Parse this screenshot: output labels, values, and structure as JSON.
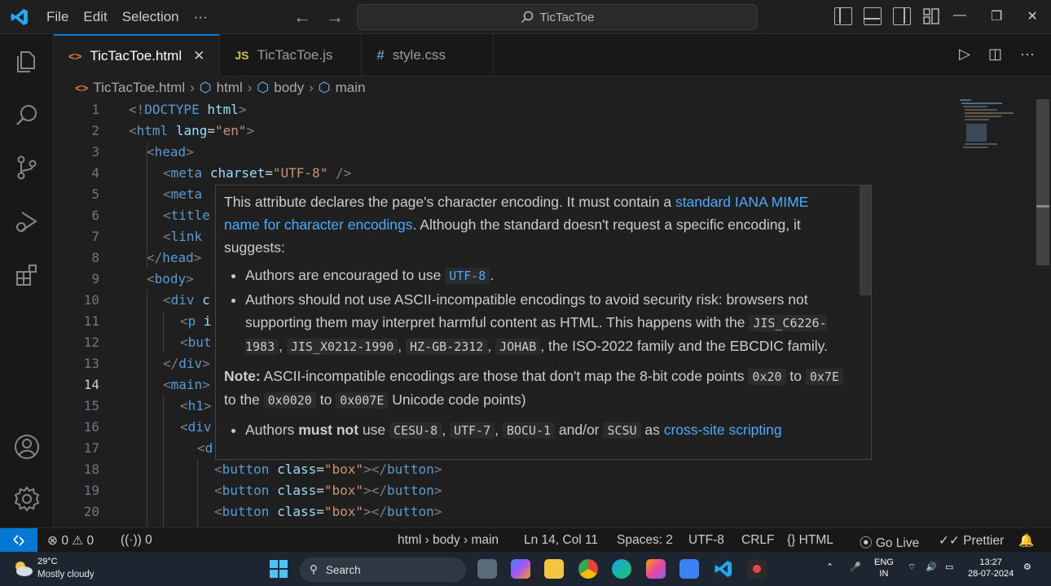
{
  "menu": {
    "file": "File",
    "edit": "Edit",
    "selection": "Selection",
    "more": "···"
  },
  "command_center": {
    "text": "TicTacToe"
  },
  "tabs": [
    {
      "icon_text": "<>",
      "label": "TicTacToe.html",
      "close": "✕"
    },
    {
      "icon_text": "JS",
      "label": "TicTacToe.js"
    },
    {
      "icon_text": "#",
      "label": "style.css"
    }
  ],
  "breadcrumb": {
    "file": "TicTacToe.html",
    "items": [
      "html",
      "body",
      "main"
    ]
  },
  "code_lines": [
    {
      "n": "1"
    },
    {
      "n": "2"
    },
    {
      "n": "3"
    },
    {
      "n": "4"
    },
    {
      "n": "5"
    },
    {
      "n": "6"
    },
    {
      "n": "7"
    },
    {
      "n": "8"
    },
    {
      "n": "9"
    },
    {
      "n": "10"
    },
    {
      "n": "11"
    },
    {
      "n": "12"
    },
    {
      "n": "13"
    },
    {
      "n": "14"
    },
    {
      "n": "15"
    },
    {
      "n": "16"
    },
    {
      "n": "17"
    },
    {
      "n": "18"
    },
    {
      "n": "19"
    },
    {
      "n": "20"
    }
  ],
  "code_text": {
    "l1_a": "<!",
    "l1_b": "DOCTYPE",
    "l1_c": "html",
    "l1_d": ">",
    "l2_tag": "html",
    "l2_attr": "lang",
    "l2_val": "\"en\"",
    "l3_tag": "head",
    "l4_tag": "meta",
    "l4_attr": "charset",
    "l4_val": "\"UTF-8\"",
    "l4_end": " />",
    "l5": "meta",
    "l6": "title",
    "l7": "link",
    "l8_tag": "head",
    "l9_tag": "body",
    "l10_tag": "div",
    "l10_rest": " c",
    "l11_tag": "p",
    "l11_rest": " i",
    "l12_tag": "but",
    "l13_tag": "div",
    "l14_tag": "main",
    "l15_tag": "h1",
    "l16_tag": "div",
    "l17_tag": "d",
    "btn_tag": "button",
    "btn_attr": "class",
    "btn_val": "\"box\""
  },
  "hover": {
    "p1_a": "This attribute declares the page's character encoding. It must contain a ",
    "p1_link": "standard IANA MIME name for character encodings",
    "p1_b": ". Although the standard doesn't request a specific encoding, it suggests:",
    "b1_a": "Authors are encouraged to use ",
    "b1_code": "UTF-8",
    "b1_b": ".",
    "b2_a": "Authors should not use ASCII-incompatible encodings to avoid security risk: browsers not supporting them may interpret harmful content as HTML. This happens with the ",
    "b2_c1": "JIS_C6226-1983",
    "b2_c2": "JIS_X0212-1990",
    "b2_c3": "HZ-GB-2312",
    "b2_c4": "JOHAB",
    "b2_b": ", the ISO-2022 family and the EBCDIC family.",
    "note_label": "Note:",
    "note_a": " ASCII-incompatible encodings are those that don't map the 8-bit code points ",
    "note_c1": "0x20",
    "note_to1": " to ",
    "note_c2": "0x7E",
    "note_to2": " to the ",
    "note_c3": "0x0020",
    "note_to3": " to ",
    "note_c4": "0x007E",
    "note_b": " Unicode code points)",
    "b3_a": "Authors ",
    "b3_strong": "must not",
    "b3_b": " use ",
    "b3_c1": "CESU-8",
    "b3_c2": "UTF-7",
    "b3_c3": "BOCU-1",
    "b3_andor": " and/or ",
    "b3_c4": "SCSU",
    "b3_as": " as ",
    "b3_link": "cross-site scripting"
  },
  "status": {
    "errors": "0",
    "warnings": "0",
    "ports": "0",
    "path": "html › body › main",
    "position": "Ln 14, Col 11",
    "spaces": "Spaces: 2",
    "encoding": "UTF-8",
    "eol": "CRLF",
    "language": "HTML",
    "golive": "Go Live",
    "prettier": "Prettier"
  },
  "taskbar": {
    "temp": "29°C",
    "weather": "Mostly cloudy",
    "search": "Search",
    "lang1": "ENG",
    "lang2": "IN",
    "time": "13:27",
    "date": "28-07-2024"
  },
  "colors": {
    "accent": "#0078d4",
    "tag": "#569cd6",
    "attr": "#9cdcfe",
    "string": "#ce9178",
    "link": "#4daafc"
  }
}
